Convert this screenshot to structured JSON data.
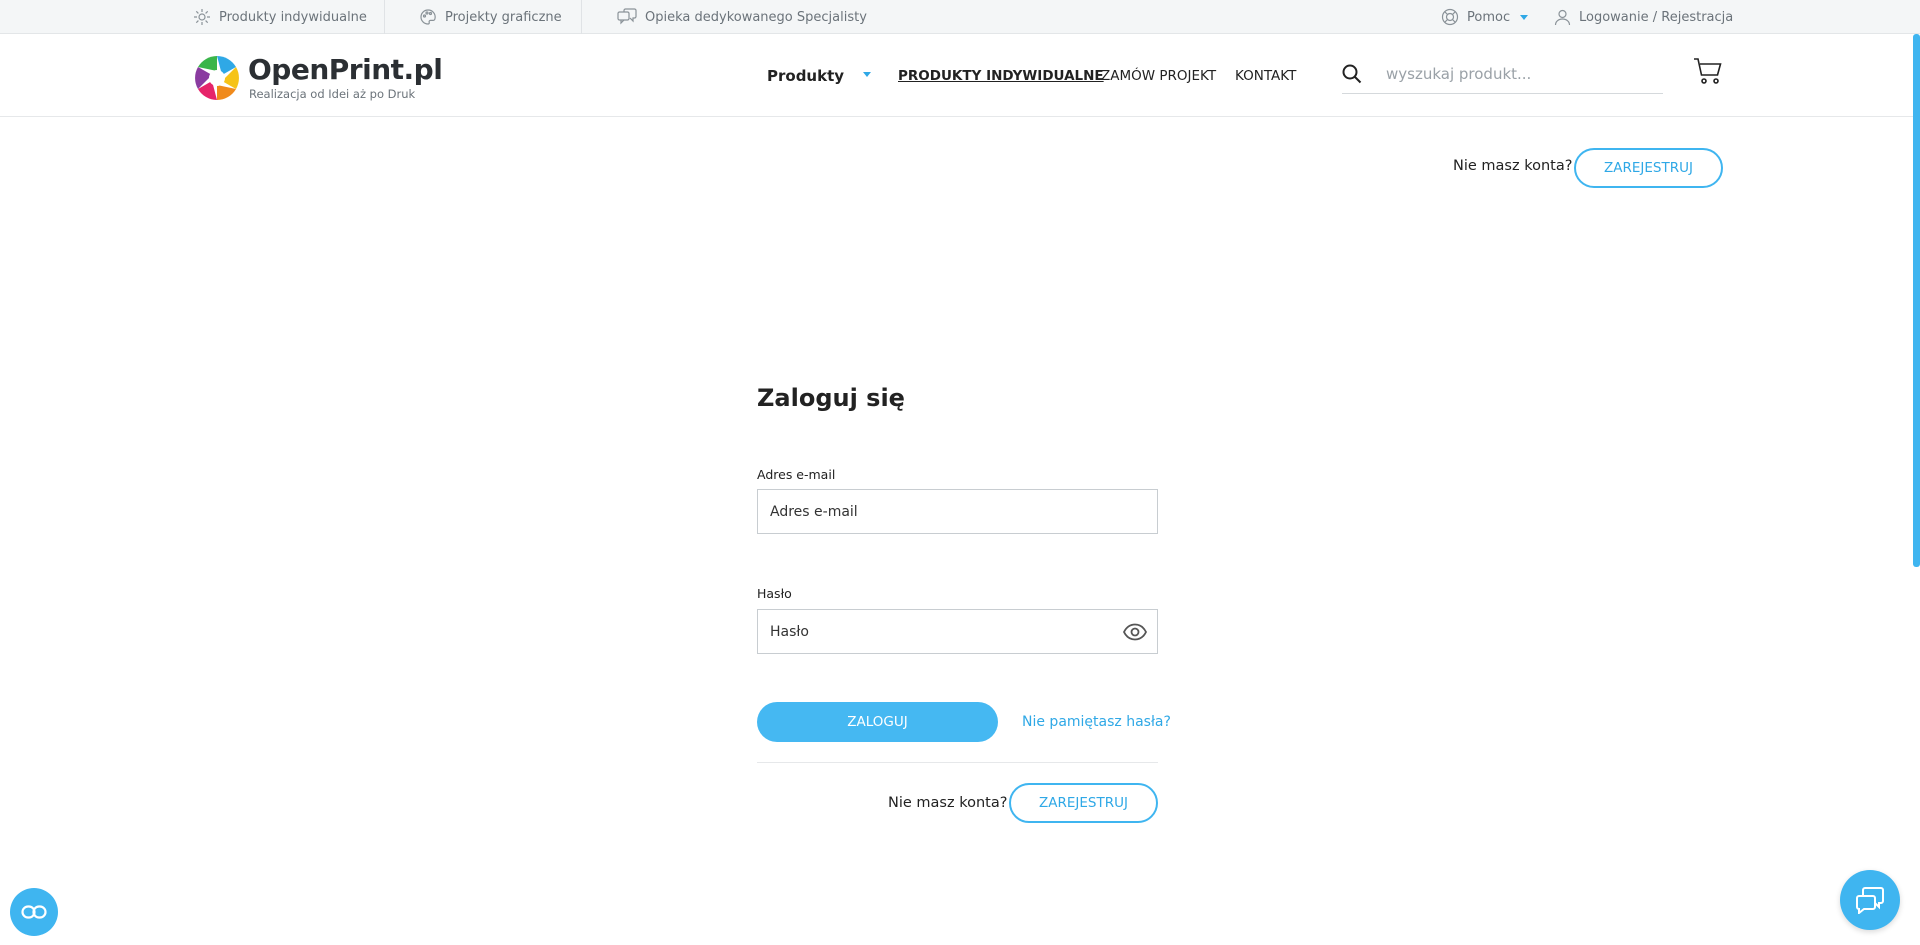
{
  "topbar": {
    "products_individual": "Produkty indywidualne",
    "graphic_projects": "Projekty graficzne",
    "specialist_care": "Opieka dedykowanego Specjalisty",
    "help": "Pomoc",
    "login_register": "Logowanie / Rejestracja"
  },
  "header": {
    "brand": "OpenPrint.pl",
    "tagline": "Realizacja od Idei aż po Druk",
    "nav_products": "Produkty",
    "nav_individual": "PRODUKTY INDYWIDUALNE",
    "nav_order_project": "ZAMÓW PROJEKT",
    "nav_contact": "KONTAKT",
    "search_placeholder": "wyszukaj produkt..."
  },
  "register_top": {
    "question": "Nie masz konta?",
    "button": "ZAREJESTRUJ"
  },
  "login": {
    "title": "Zaloguj się",
    "email_label": "Adres e-mail",
    "email_placeholder": "Adres e-mail",
    "password_label": "Hasło",
    "password_placeholder": "Hasło",
    "submit": "ZALOGUJ",
    "forgot": "Nie pamiętasz hasła?",
    "no_account": "Nie masz konta?",
    "register": "ZAREJESTRUJ"
  },
  "colors": {
    "accent": "#3fb5f0",
    "text": "#222222",
    "muted": "#6b737a"
  }
}
